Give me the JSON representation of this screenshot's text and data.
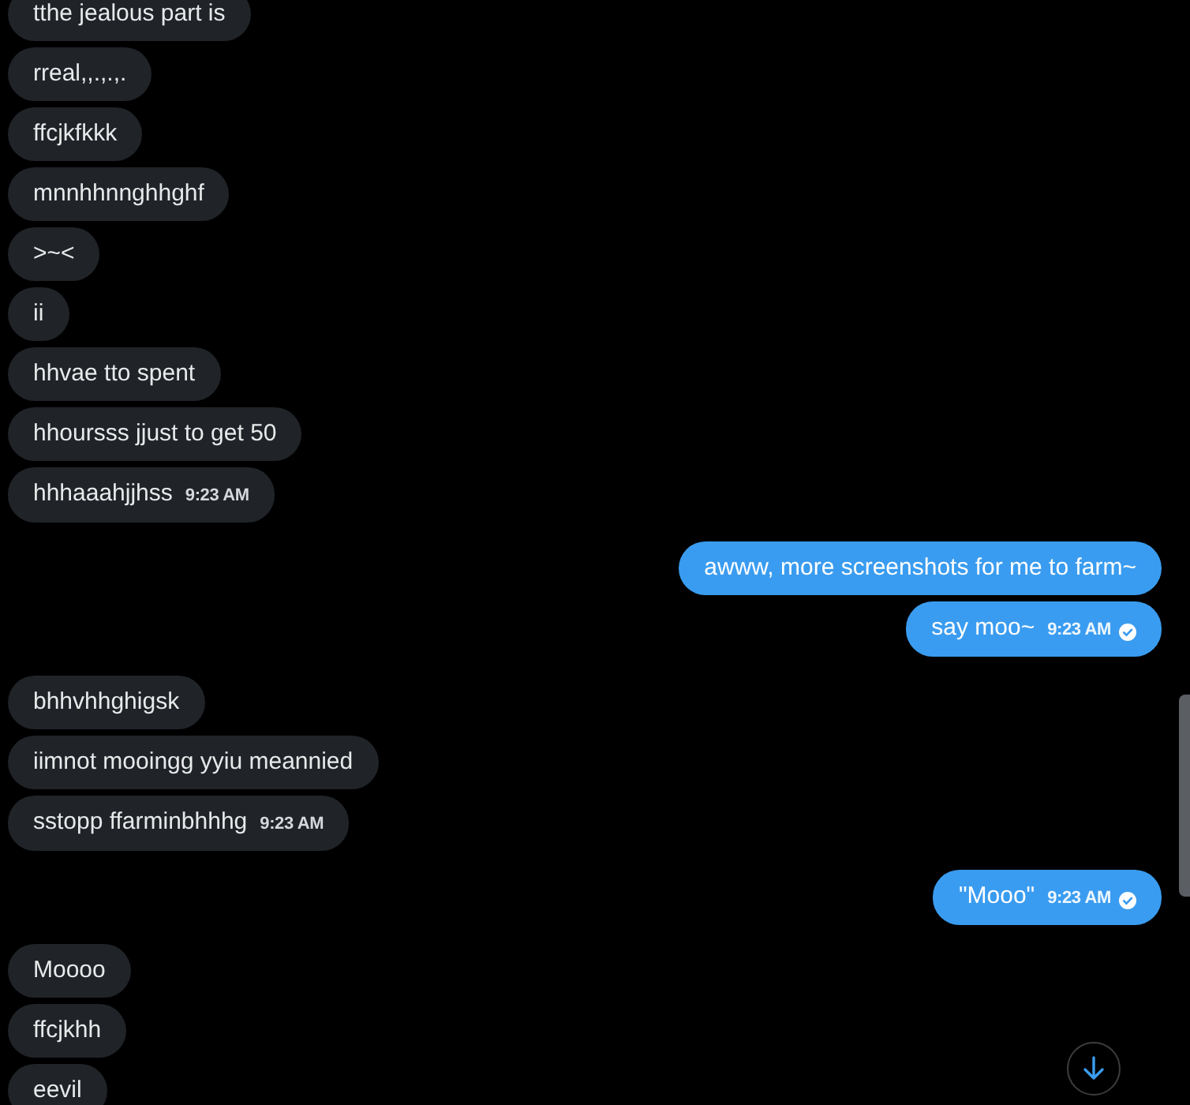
{
  "conversation": [
    {
      "kind": "received",
      "messages": [
        {
          "text": "tthe jealous part is"
        },
        {
          "text": "rreal,,.,.,."
        },
        {
          "text": "ffcjkfkkk"
        },
        {
          "text": "mnnhhnnghhghf"
        },
        {
          "text": ">~<"
        },
        {
          "text": "ii"
        },
        {
          "text": "hhvae tto spent"
        },
        {
          "text": "hhoursss jjust to get 50"
        },
        {
          "text": "hhhaaahjjhss",
          "time": "9:23 AM"
        }
      ]
    },
    {
      "kind": "sent",
      "messages": [
        {
          "text": "awww, more screenshots for me to farm~"
        },
        {
          "text": "say moo~",
          "time": "9:23 AM",
          "read": true
        }
      ]
    },
    {
      "kind": "received",
      "messages": [
        {
          "text": "bhhvhhghigsk"
        },
        {
          "text": "iimnot mooingg yyiu meannied"
        },
        {
          "text": "sstopp ffarminbhhhg",
          "time": "9:23 AM"
        }
      ]
    },
    {
      "kind": "sent",
      "messages": [
        {
          "text": "\"Mooo\"",
          "time": "9:23 AM",
          "read": true
        }
      ]
    },
    {
      "kind": "received",
      "messages": [
        {
          "text": "Moooo"
        },
        {
          "text": "ffcjkhh"
        },
        {
          "text": "eevil"
        }
      ]
    }
  ],
  "scroll_to_bottom": {
    "visible": true
  }
}
